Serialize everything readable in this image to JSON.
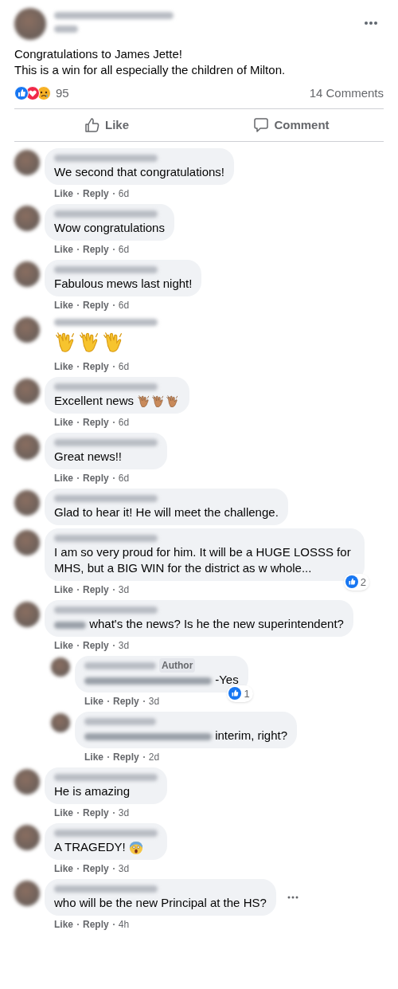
{
  "post": {
    "text": [
      "Congratulations to James Jette!",
      "This is a win for all especially the children of Milton."
    ],
    "reactions": [
      {
        "kind": "like"
      },
      {
        "kind": "love"
      },
      {
        "kind": "sad"
      }
    ],
    "reaction_count": "95",
    "comment_count": "14 Comments",
    "actions": [
      {
        "kind": "like",
        "label": "Like"
      },
      {
        "kind": "comment",
        "label": "Comment"
      }
    ]
  },
  "comments": [
    {
      "text": "We second that congratulations!",
      "meta": [
        "Like",
        "Reply",
        "6d"
      ]
    },
    {
      "text": "Wow congratulations",
      "meta": [
        "Like",
        "Reply",
        "6d"
      ]
    },
    {
      "text": "Fabulous mews last night!",
      "meta": [
        "Like",
        "Reply",
        "6d"
      ]
    },
    {
      "emojis": [
        {
          "kind": "clap"
        },
        {
          "kind": "clap"
        },
        {
          "kind": "clap"
        }
      ],
      "meta": [
        "Like",
        "Reply",
        "6d"
      ]
    },
    {
      "text": "Excellent news",
      "inline_emojis": [
        {
          "kind": "clap-dark"
        },
        {
          "kind": "clap-dark"
        },
        {
          "kind": "clap-dark"
        }
      ],
      "meta": [
        "Like",
        "Reply",
        "6d"
      ]
    },
    {
      "text": "Great news!!",
      "meta": [
        "Like",
        "Reply",
        "6d"
      ]
    },
    {
      "text": "Glad to hear it! He will meet the challenge."
    },
    {
      "text": "I am so very proud for him. It will be a HUGE LOSSS for MHS, but a BIG WIN for the district as w whole...",
      "likes": "2",
      "meta": [
        "Like",
        "Reply",
        "3d"
      ]
    },
    {
      "text": "what's the news? Is he the new superintendent?",
      "mention": true,
      "meta": [
        "Like",
        "Reply",
        "3d"
      ],
      "children": [
        {
          "badge": "Author",
          "text": "-Yes",
          "mention": true,
          "likes": "1",
          "meta": [
            "Like",
            "Reply",
            "3d"
          ]
        },
        {
          "text": "interim, right?",
          "mention": true,
          "meta": [
            "Like",
            "Reply",
            "2d"
          ]
        }
      ]
    },
    {
      "text": "He is amazing",
      "meta": [
        "Like",
        "Reply",
        "3d"
      ]
    },
    {
      "text": "A TRAGEDY!",
      "inline_emojis": [
        {
          "kind": "scream"
        }
      ],
      "meta": [
        "Like",
        "Reply",
        "3d"
      ]
    },
    {
      "text": "who will be the new Principal at the HS?",
      "menu": true,
      "meta": [
        "Like",
        "Reply",
        "4h"
      ]
    }
  ]
}
